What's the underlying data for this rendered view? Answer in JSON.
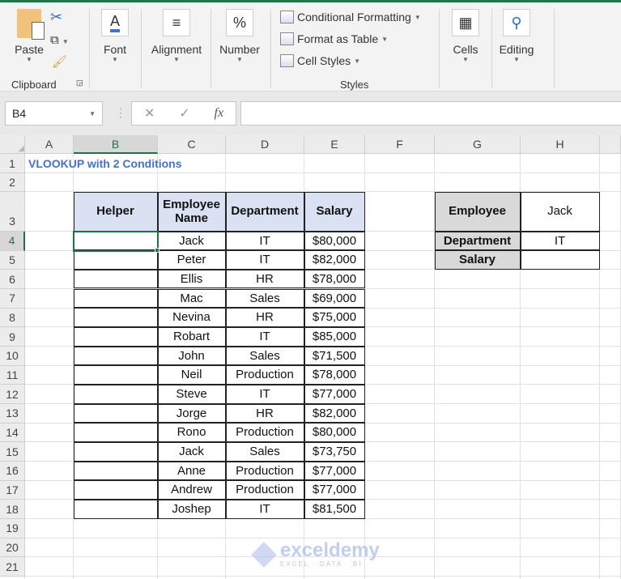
{
  "ribbon": {
    "paste": "Paste",
    "clipboard": "Clipboard",
    "font": "Font",
    "alignment": "Alignment",
    "number": "Number",
    "conditional_formatting": "Conditional Formatting",
    "format_as_table": "Format as Table",
    "cell_styles": "Cell Styles",
    "styles": "Styles",
    "cells": "Cells",
    "editing": "Editing"
  },
  "formula_bar": {
    "name_box": "B4",
    "formula": ""
  },
  "columns": [
    "A",
    "B",
    "C",
    "D",
    "E",
    "F",
    "G",
    "H"
  ],
  "selected_cell": "B4",
  "rows": [
    "1",
    "2",
    "3",
    "4",
    "5",
    "6",
    "7",
    "8",
    "9",
    "10",
    "11",
    "12",
    "13",
    "14",
    "15",
    "16",
    "17",
    "18",
    "19",
    "20",
    "21"
  ],
  "sheet": {
    "title": "VLOOKUP with 2 Conditions",
    "headers": [
      "Helper",
      "Employee Name",
      "Department",
      "Salary"
    ],
    "data": [
      [
        "",
        "Jack",
        "IT",
        "$80,000"
      ],
      [
        "",
        "Peter",
        "IT",
        "$82,000"
      ],
      [
        "",
        "Ellis",
        "HR",
        "$78,000"
      ],
      [
        "",
        "Mac",
        "Sales",
        "$69,000"
      ],
      [
        "",
        "Nevina",
        "HR",
        "$75,000"
      ],
      [
        "",
        "Robart",
        "IT",
        "$85,000"
      ],
      [
        "",
        "John",
        "Sales",
        "$71,500"
      ],
      [
        "",
        "Neil",
        "Production",
        "$78,000"
      ],
      [
        "",
        "Steve",
        "IT",
        "$77,000"
      ],
      [
        "",
        "Jorge",
        "HR",
        "$82,000"
      ],
      [
        "",
        "Rono",
        "Production",
        "$80,000"
      ],
      [
        "",
        "Jack",
        "Sales",
        "$73,750"
      ],
      [
        "",
        "Anne",
        "Production",
        "$77,000"
      ],
      [
        "",
        "Andrew",
        "Production",
        "$77,000"
      ],
      [
        "",
        "Joshep",
        "IT",
        "$81,500"
      ]
    ],
    "lookup": [
      [
        "Employee",
        "Jack"
      ],
      [
        "Department",
        "IT"
      ],
      [
        "Salary",
        ""
      ]
    ]
  },
  "watermark": {
    "name": "exceldemy",
    "tagline": "EXCEL · DATA · BI"
  },
  "colors": {
    "accent": "#217346",
    "header_fill": "#d9e1f2",
    "title": "#4472c4"
  }
}
